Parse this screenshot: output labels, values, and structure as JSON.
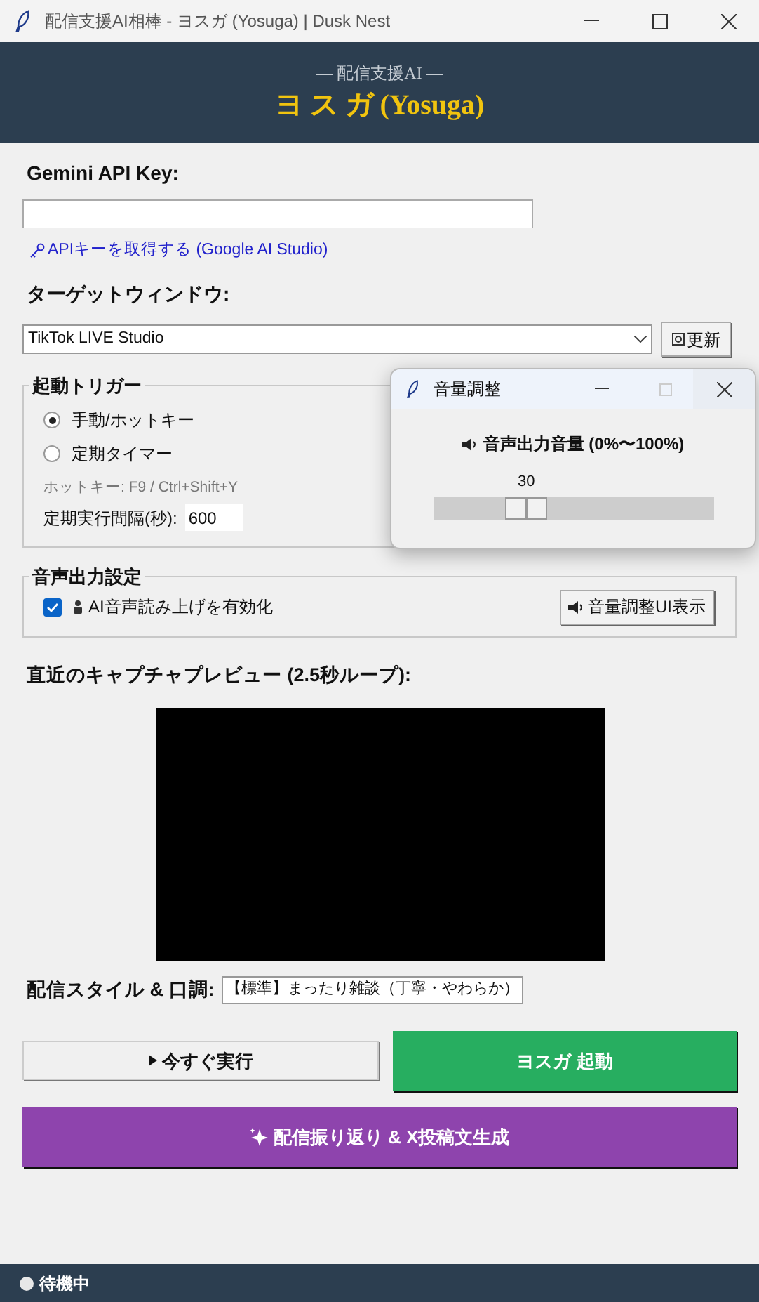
{
  "window": {
    "title": "配信支援AI相棒 - ヨスガ (Yosuga) | Dusk Nest"
  },
  "header": {
    "subtitle": "― 配信支援AI ―",
    "title": "ヨ ス ガ (Yosuga)"
  },
  "api_key": {
    "label": "Gemini API Key:",
    "link": "APIキーを取得する (Google AI Studio)"
  },
  "target": {
    "label": "ターゲットウィンドウ:",
    "value": "TikTok LIVE Studio",
    "refresh": "更新"
  },
  "trigger": {
    "legend": "起動トリガー",
    "options": [
      {
        "label": "手動/ホットキー",
        "selected": true
      },
      {
        "label": "定期タイマー",
        "selected": false
      }
    ],
    "hotkey_note": "ホットキー: F9 / Ctrl+Shift+Y",
    "interval_label": "定期実行間隔(秒):",
    "interval_value": "600"
  },
  "audio": {
    "legend": "音声出力設定",
    "tts": {
      "label": "AI音声読み上げを有効化",
      "checked": true
    },
    "volume_button": "音量調整UI表示"
  },
  "preview": {
    "label": "直近のキャプチャプレビュー (2.5秒ループ):"
  },
  "style": {
    "label": "配信スタイル & 口調:",
    "value": "【標準】まったり雑談（丁寧・やわらか）"
  },
  "buttons": {
    "run_now": "今すぐ実行",
    "start": "ヨスガ 起動",
    "review": "配信振り返り & X投稿文生成"
  },
  "status_bar": {
    "text": "待機中"
  },
  "volume_window": {
    "title": "音量調整",
    "heading": "音声出力音量 (0%〜100%)",
    "reading": "30",
    "level": 0.3
  }
}
